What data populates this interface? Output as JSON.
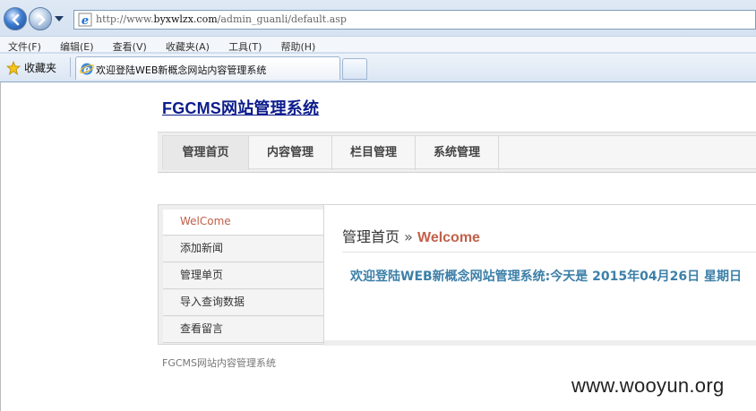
{
  "browser": {
    "url_prefix": "http://www.",
    "url_domain": "byxwlzx.com",
    "url_path": "/admin_guanli/default.asp",
    "menu": [
      "文件(F)",
      "编辑(E)",
      "查看(V)",
      "收藏夹(A)",
      "工具(T)",
      "帮助(H)"
    ],
    "favorites_label": "收藏夹",
    "tab_title": "欢迎登陆WEB新概念网站内容管理系统"
  },
  "site": {
    "title": "FGCMS网站管理系统"
  },
  "topnav": {
    "items": [
      "管理首页",
      "内容管理",
      "栏目管理",
      "系统管理"
    ]
  },
  "sidebar": {
    "items": [
      "WelCome",
      "添加新闻",
      "管理单页",
      "导入查询数据",
      "查看留言"
    ]
  },
  "main": {
    "crumb_home": "管理首页",
    "crumb_sep": "»",
    "crumb_current": "Welcome",
    "welcome_message": "欢迎登陆WEB新概念网站管理系统:今天是 2015年04月26日 星期日"
  },
  "footer": {
    "text": "FGCMS网站内容管理系统"
  },
  "watermark": "www.wooyun.org"
}
